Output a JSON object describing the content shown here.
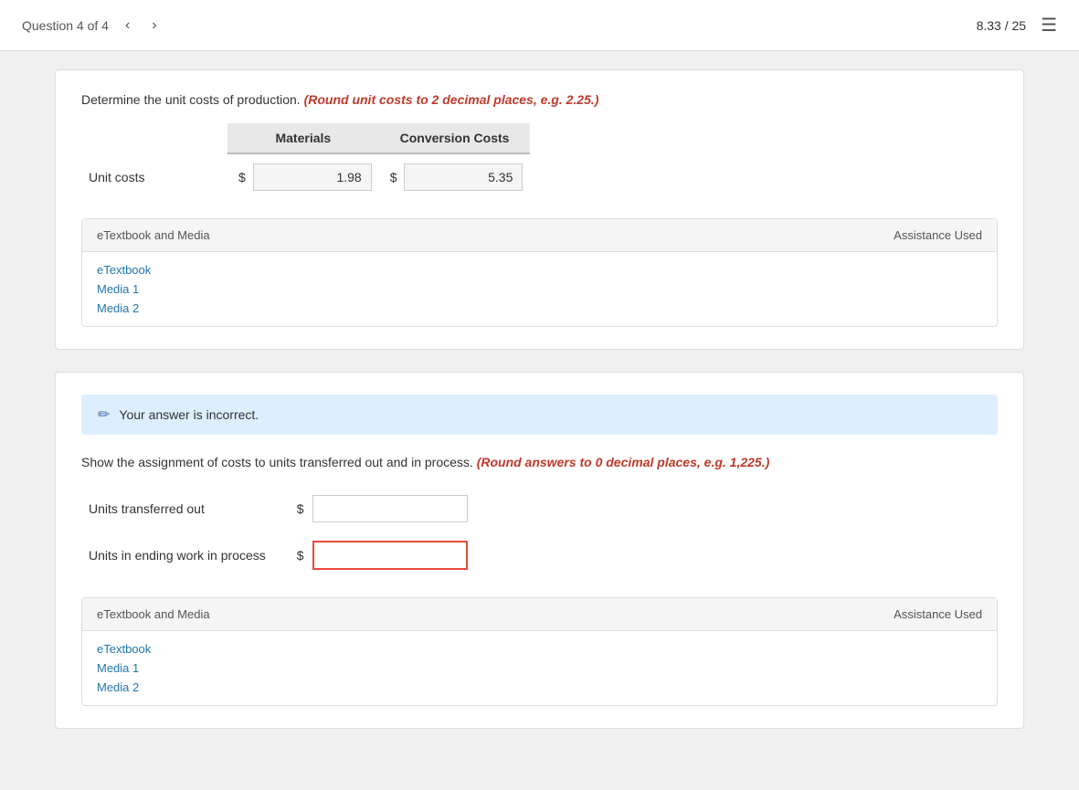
{
  "topbar": {
    "question_label": "Question 4 of 4",
    "score": "8.33 / 25"
  },
  "first_card": {
    "instruction": "Determine the unit costs of production.",
    "instruction_highlight": "(Round unit costs to 2 decimal places, e.g. 2.25.)",
    "col_materials": "Materials",
    "col_conversion": "Conversion Costs",
    "row_label": "Unit costs",
    "materials_value": "1.98",
    "conversion_value": "5.35",
    "etextbook_header_label": "eTextbook and Media",
    "etextbook_header_right": "Assistance Used",
    "links": [
      "eTextbook",
      "Media 1",
      "Media 2"
    ]
  },
  "second_card": {
    "incorrect_message": "Your answer is incorrect.",
    "instruction": "Show the assignment of costs to units transferred out and in process.",
    "instruction_highlight": "(Round answers to 0 decimal places, e.g. 1,225.)",
    "row1_label": "Units transferred out",
    "row1_value": "",
    "row2_label": "Units in ending work in process",
    "row2_value": "",
    "etextbook_header_label": "eTextbook and Media",
    "etextbook_header_right": "Assistance Used",
    "links": [
      "eTextbook",
      "Media 1",
      "Media 2"
    ]
  }
}
